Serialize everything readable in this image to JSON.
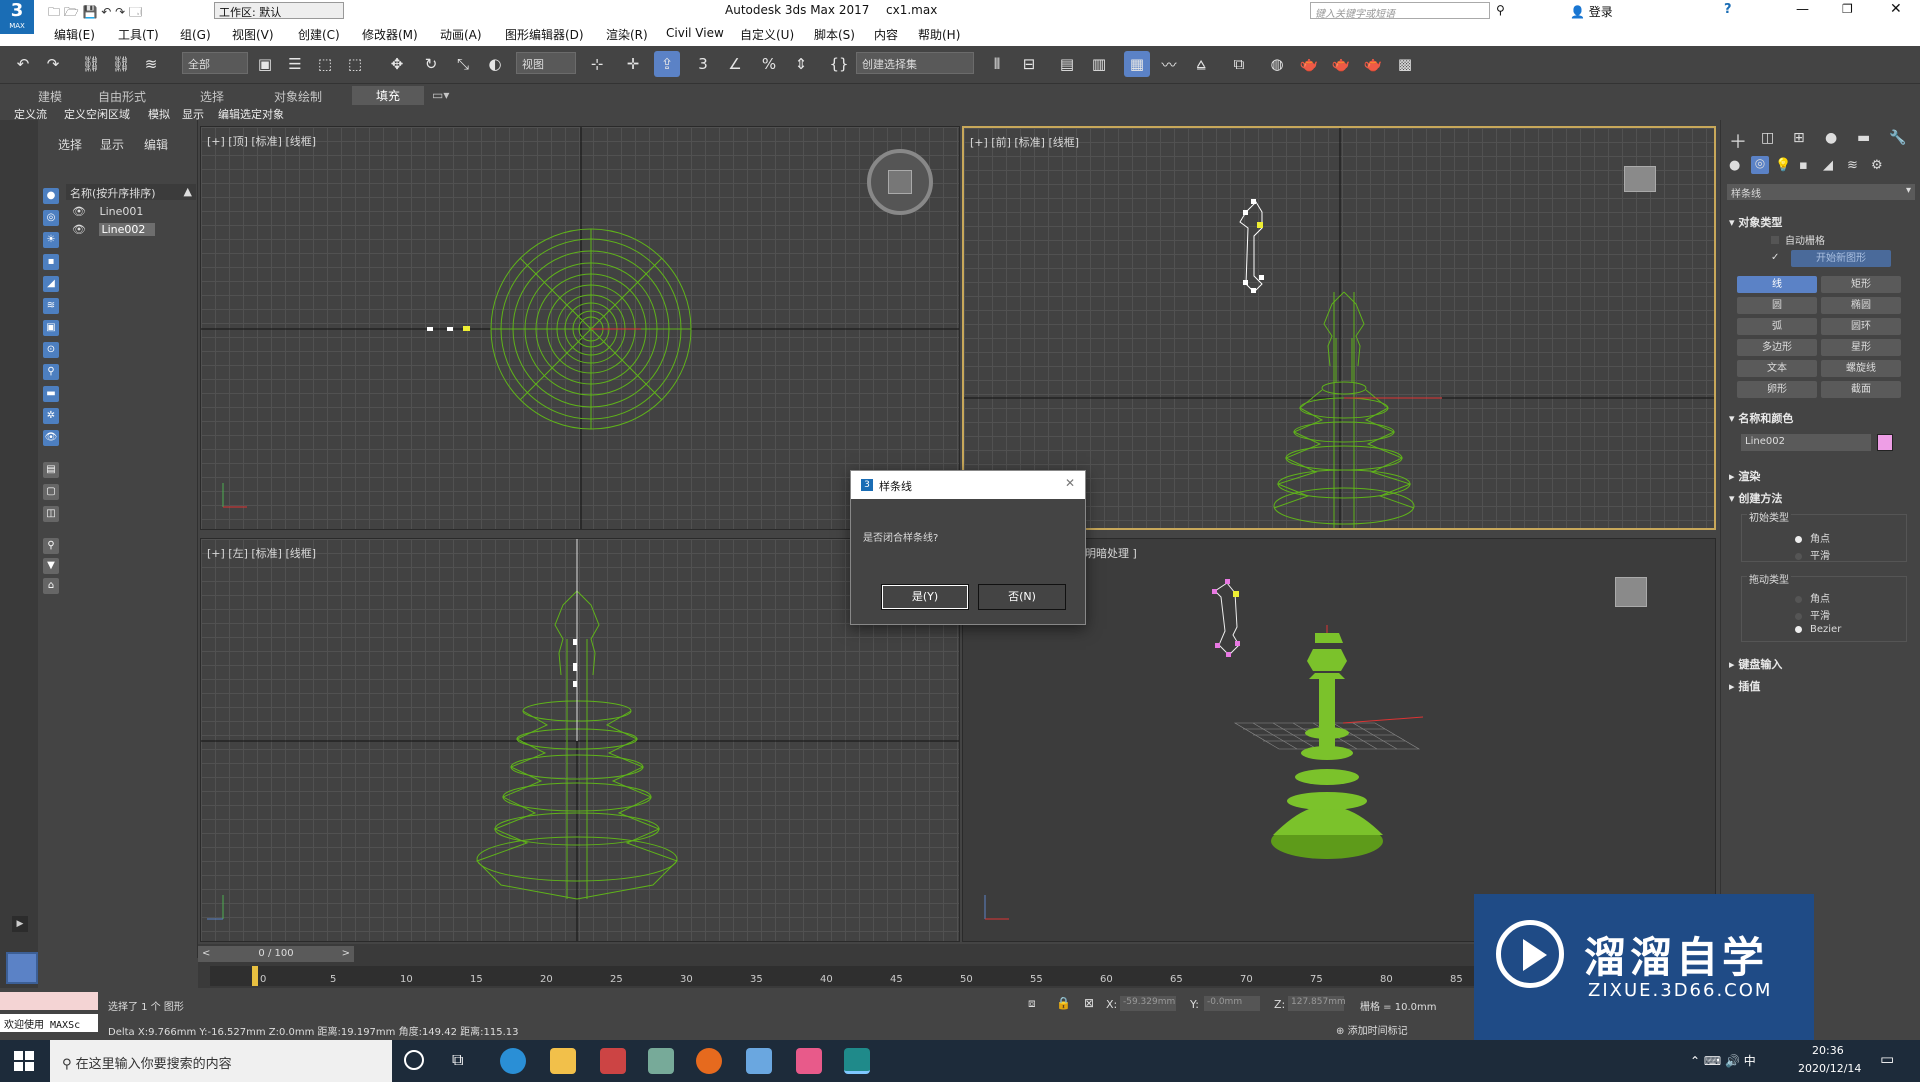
{
  "titlebar": {
    "workspace_label": "工作区: 默认",
    "app_title": "Autodesk 3ds Max 2017",
    "file_name": "cx1.max",
    "search_placeholder": "键入关键字或短语",
    "login": "登录",
    "app_badge": "MAX"
  },
  "menu": [
    "编辑(E)",
    "工具(T)",
    "组(G)",
    "视图(V)",
    "创建(C)",
    "修改器(M)",
    "动画(A)",
    "图形编辑器(D)",
    "渲染(R)",
    "Civil View",
    "自定义(U)",
    "脚本(S)",
    "内容",
    "帮助(H)"
  ],
  "toolbar": {
    "filter_combo": "全部",
    "view_combo": "视图",
    "selection_set": "创建选择集"
  },
  "ribbon": {
    "tabs": [
      "建模",
      "自由形式",
      "选择",
      "对象绘制",
      "填充"
    ],
    "subtabs": [
      "定义流",
      "定义空闲区域",
      "模拟",
      "显示",
      "编辑选定对象"
    ]
  },
  "scene_explorer": {
    "tabs": [
      "选择",
      "显示",
      "编辑"
    ],
    "header": "名称(按升序排序)",
    "items": [
      "Line001",
      "Line002"
    ]
  },
  "viewports": {
    "top": "[+] [顶] [标准] [线框]",
    "front": "[+] [前] [标准] [线框]",
    "left": "[+] [左] [标准] [线框]",
    "persp": "明暗处理 ]"
  },
  "dialog": {
    "title": "样条线",
    "message": "是否闭合样条线?",
    "yes": "是(Y)",
    "no": "否(N)"
  },
  "command_panel": {
    "category": "样条线",
    "object_type": "对象类型",
    "auto_grid": "自动栅格",
    "start_new_shape": "开始新图形",
    "buttons": [
      "线",
      "矩形",
      "圆",
      "椭圆",
      "弧",
      "圆环",
      "多边形",
      "星形",
      "文本",
      "螺旋线",
      "卵形",
      "截面"
    ],
    "name_color": "名称和颜色",
    "object_name": "Line002",
    "name_swatch": "#ee9ee6",
    "render": "渲染",
    "creation_method": "创建方法",
    "initial_type": "初始类型",
    "drag_type": "拖动类型",
    "corner": "角点",
    "smooth": "平滑",
    "bezier": "Bezier",
    "keyboard_input": "键盘输入",
    "interpolation": "插值"
  },
  "timeline": {
    "frame": "0 / 100",
    "ticks": [
      "0",
      "5",
      "10",
      "15",
      "20",
      "25",
      "30",
      "35",
      "40",
      "45",
      "50",
      "55",
      "60",
      "65",
      "70",
      "75",
      "80",
      "85"
    ]
  },
  "status": {
    "selection": "选择了 1 个 图形",
    "welcome": "欢迎使用 MAXSc",
    "delta": "Delta X:9.766mm  Y:-16.527mm  Z:0.0mm  距离:19.197mm 角度:149.42 距离:115.13",
    "x_label": "X:",
    "x_value": "-59.329mm",
    "y_label": "Y:",
    "y_value": "-0.0mm",
    "z_label": "Z:",
    "z_value": "127.857mm",
    "grid": "栅格 = 10.0mm",
    "add_time_tag": "添加时间标记"
  },
  "taskbar": {
    "search": "在这里输入你要搜索的内容",
    "time": "20:36",
    "date": "2020/12/14"
  },
  "watermark": {
    "brand": "溜溜自学",
    "url": "ZIXUE.3D66.COM"
  },
  "colors": {
    "wire_green": "#5fb31a",
    "solid_green": "#7bc22b",
    "accent_blue": "#5b82c6",
    "active_viewport": "#c8a85a"
  }
}
